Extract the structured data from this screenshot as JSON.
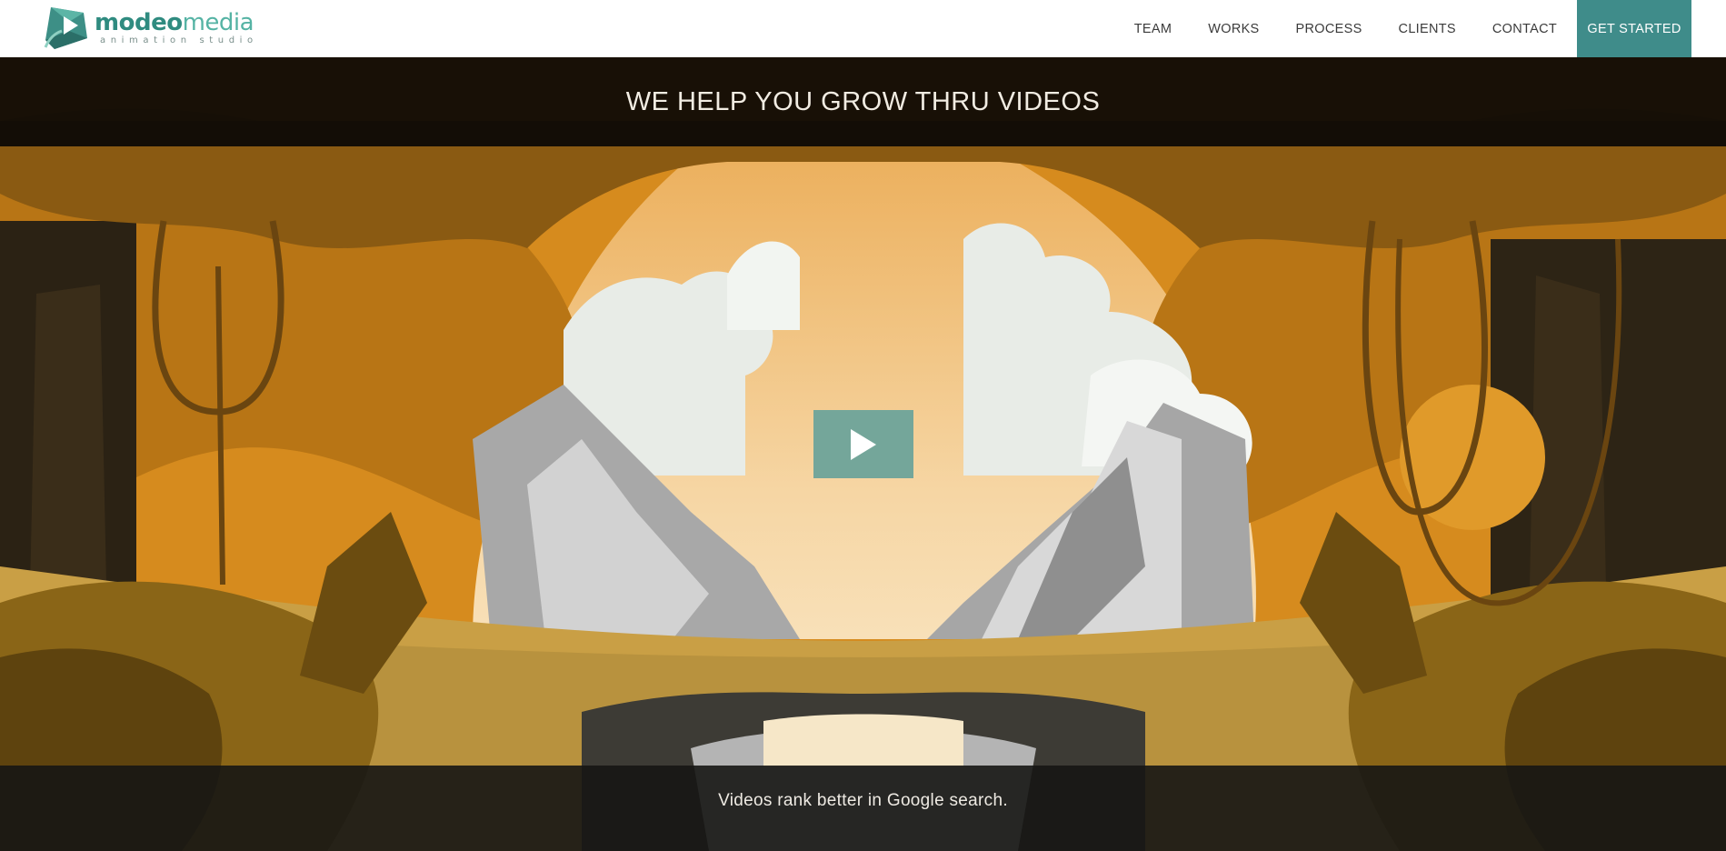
{
  "brand": {
    "name_part1": "modeo",
    "name_part2": "media",
    "tagline": "animation studio",
    "colors": {
      "primary": "#3f8c8a",
      "accent": "#55b3a4"
    }
  },
  "nav": {
    "items": [
      "TEAM",
      "WORKS",
      "PROCESS",
      "CLIENTS",
      "CONTACT"
    ],
    "cta_label": "GET STARTED"
  },
  "hero": {
    "title": "WE HELP YOU GROW THRU VIDEOS",
    "caption": "Videos rank better in Google search.",
    "play_icon": "play-icon",
    "play_color": "#74a69a"
  }
}
